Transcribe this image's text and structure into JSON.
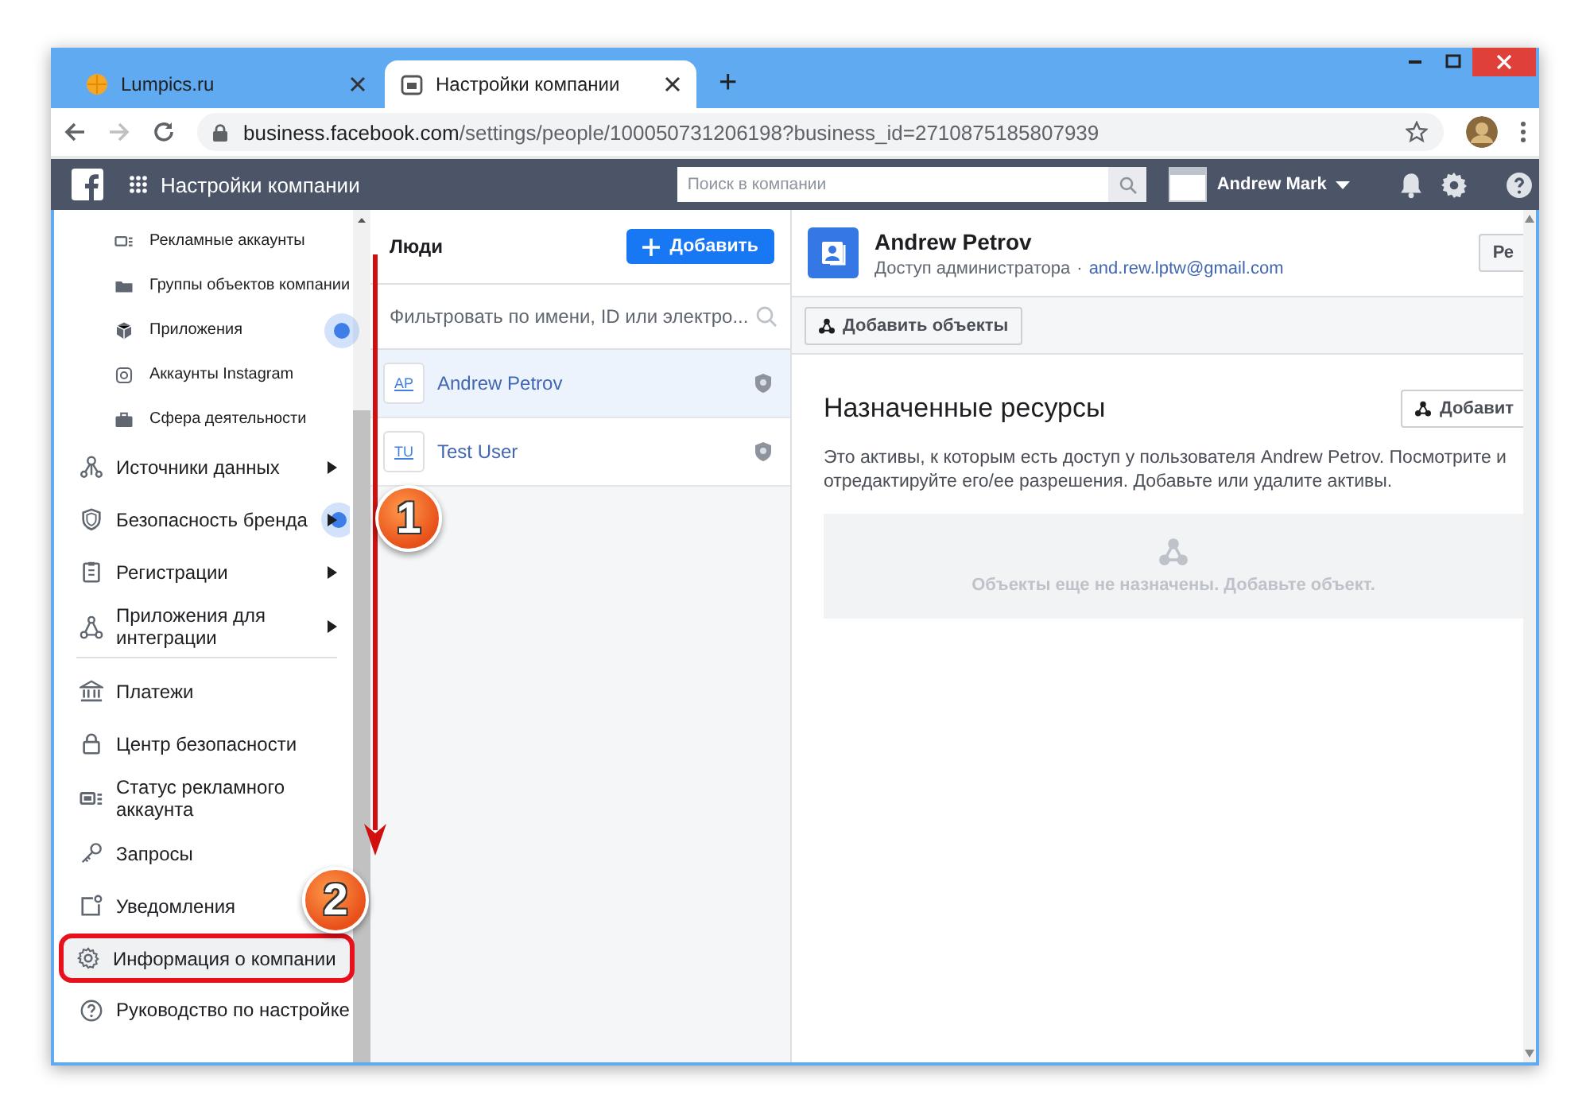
{
  "browser": {
    "tabs": [
      {
        "title": "Lumpics.ru",
        "selected": false
      },
      {
        "title": "Настройки компании",
        "selected": true
      }
    ],
    "new_tab": "+",
    "url_host": "business.facebook.com",
    "url_path": "/settings/people/100050731206198?business_id=2710875185807939"
  },
  "header": {
    "title": "Настройки компании",
    "search_placeholder": "Поиск в компании",
    "user": "Andrew Mark"
  },
  "sidebar": {
    "items": [
      {
        "kind": "sub",
        "label": "Рекламные аккаунты",
        "expandable": false,
        "dot": false,
        "highlighted": false,
        "divider_after": false
      },
      {
        "kind": "sub",
        "label": "Группы объектов компании",
        "expandable": false,
        "dot": false,
        "highlighted": false,
        "divider_after": false
      },
      {
        "kind": "sub",
        "label": "Приложения",
        "expandable": false,
        "dot": true,
        "highlighted": false,
        "divider_after": false
      },
      {
        "kind": "sub",
        "label": "Аккаунты Instagram",
        "expandable": false,
        "dot": false,
        "highlighted": false,
        "divider_after": false
      },
      {
        "kind": "sub",
        "label": "Сфера деятельности",
        "expandable": false,
        "dot": false,
        "highlighted": false,
        "divider_after": false
      },
      {
        "kind": "main",
        "label": "Источники данных",
        "expandable": true,
        "dot": false,
        "highlighted": false,
        "divider_after": false
      },
      {
        "kind": "main",
        "label": "Безопасность бренда",
        "expandable": true,
        "dot": true,
        "highlighted": false,
        "divider_after": false
      },
      {
        "kind": "main",
        "label": "Регистрации",
        "expandable": true,
        "dot": false,
        "highlighted": false,
        "divider_after": false
      },
      {
        "kind": "main",
        "label": "Приложения для интеграции",
        "expandable": true,
        "dot": false,
        "highlighted": false,
        "divider_after": true
      },
      {
        "kind": "main",
        "label": "Платежи",
        "expandable": false,
        "dot": false,
        "highlighted": false,
        "divider_after": false
      },
      {
        "kind": "main",
        "label": "Центр безопасности",
        "expandable": false,
        "dot": false,
        "highlighted": false,
        "divider_after": false
      },
      {
        "kind": "main",
        "label": "Статус рекламного аккаунта",
        "expandable": false,
        "dot": false,
        "highlighted": false,
        "divider_after": false
      },
      {
        "kind": "main",
        "label": "Запросы",
        "expandable": false,
        "dot": false,
        "highlighted": false,
        "divider_after": false
      },
      {
        "kind": "main",
        "label": "Уведомления",
        "expandable": false,
        "dot": false,
        "highlighted": false,
        "divider_after": false
      },
      {
        "kind": "main",
        "label": "Информация о компании",
        "expandable": false,
        "dot": false,
        "highlighted": true,
        "divider_after": false
      },
      {
        "kind": "main",
        "label": "Руководство по настройке",
        "expandable": false,
        "dot": false,
        "highlighted": false,
        "divider_after": false
      }
    ]
  },
  "people": {
    "title": "Люди",
    "add_button": "Добавить",
    "filter_placeholder": "Фильтровать по имени, ID или электро...",
    "rows": [
      {
        "initials": "AP",
        "name": "Andrew Petrov",
        "selected": true
      },
      {
        "initials": "TU",
        "name": "Test User",
        "selected": false
      }
    ]
  },
  "detail": {
    "name": "Andrew Petrov",
    "role": "Доступ администратора",
    "separator": "·",
    "email": "and.rew.lptw@gmail.com",
    "edit_button": "Ре",
    "add_objects_button": "Добавить объекты",
    "section_title": "Назначенные ресурсы",
    "section_button": "Добавит",
    "description": "Это активы, к которым есть доступ у пользователя Andrew Petrov. Посмотрите и отредактируйте его/ее разрешения. Добавьте или удалите активы.",
    "empty_text": "Объекты еще не назначены. Добавьте объект."
  },
  "callouts": [
    {
      "label": "1"
    },
    {
      "label": "2"
    }
  ]
}
